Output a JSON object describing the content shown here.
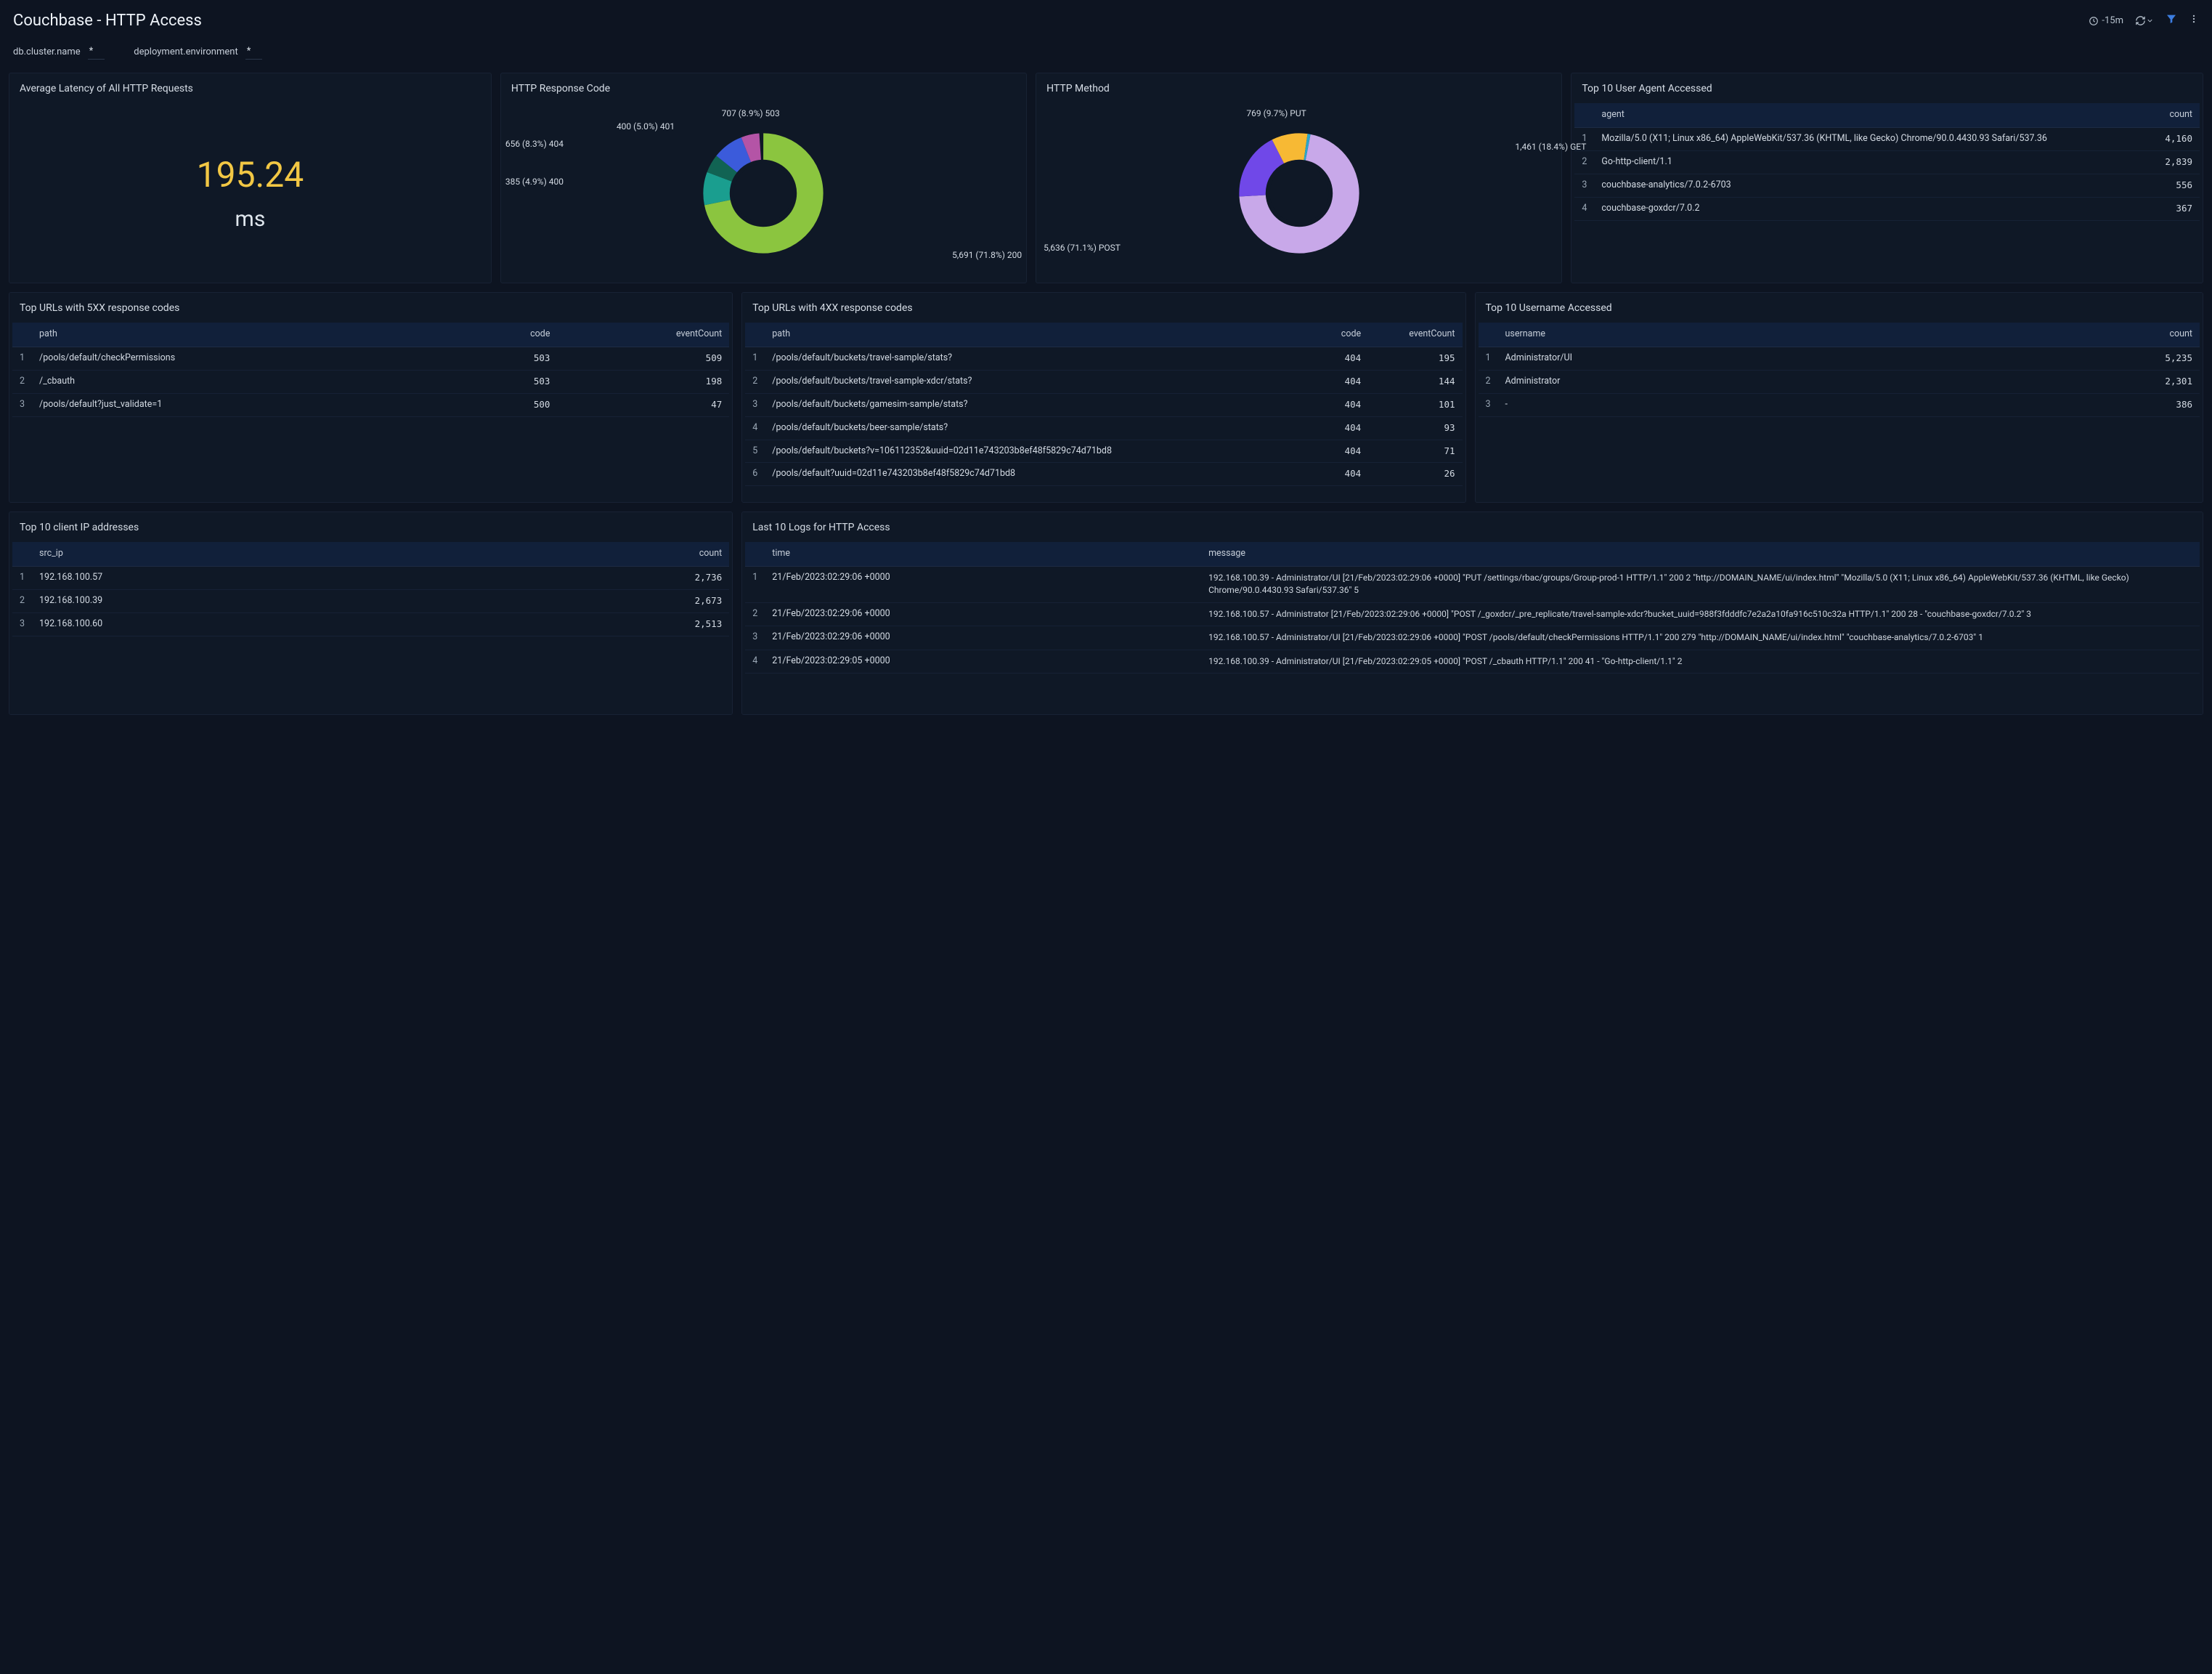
{
  "title": "Couchbase - HTTP Access",
  "time_range": "-15m",
  "filters": [
    {
      "label": "db.cluster.name",
      "value": "*"
    },
    {
      "label": "deployment.environment",
      "value": "*"
    }
  ],
  "latency": {
    "title": "Average Latency of All HTTP Requests",
    "value": "195.24",
    "unit": "ms"
  },
  "resp_code": {
    "title": "HTTP Response Code",
    "labels": {
      "c503": "707 (8.9%) 503",
      "c401": "400 (5.0%) 401",
      "c404": "656 (8.3%) 404",
      "c400": "385 (4.9%) 400",
      "c200": "5,691 (71.8%) 200"
    }
  },
  "method": {
    "title": "HTTP Method",
    "labels": {
      "put": "769 (9.7%) PUT",
      "get": "1,461 (18.4%) GET",
      "post": "5,636 (71.1%) POST"
    }
  },
  "agents": {
    "title": "Top 10 User Agent Accessed",
    "cols": {
      "agent": "agent",
      "count": "count"
    },
    "rows": [
      {
        "agent": "Mozilla/5.0 (X11; Linux x86_64) AppleWebKit/537.36 (KHTML, like Gecko) Chrome/90.0.4430.93 Safari/537.36",
        "count": "4,160"
      },
      {
        "agent": "Go-http-client/1.1",
        "count": "2,839"
      },
      {
        "agent": "couchbase-analytics/7.0.2-6703",
        "count": "556"
      },
      {
        "agent": "couchbase-goxdcr/7.0.2",
        "count": "367"
      }
    ]
  },
  "urls5xx": {
    "title": "Top URLs with 5XX response codes",
    "cols": {
      "path": "path",
      "code": "code",
      "ev": "eventCount"
    },
    "rows": [
      {
        "path": "/pools/default/checkPermissions",
        "code": "503",
        "ev": "509"
      },
      {
        "path": "/_cbauth",
        "code": "503",
        "ev": "198"
      },
      {
        "path": "/pools/default?just_validate=1",
        "code": "500",
        "ev": "47"
      }
    ]
  },
  "urls4xx": {
    "title": "Top URLs with 4XX response codes",
    "cols": {
      "path": "path",
      "code": "code",
      "ev": "eventCount"
    },
    "rows": [
      {
        "path": "/pools/default/buckets/travel-sample/stats?",
        "code": "404",
        "ev": "195"
      },
      {
        "path": "/pools/default/buckets/travel-sample-xdcr/stats?",
        "code": "404",
        "ev": "144"
      },
      {
        "path": "/pools/default/buckets/gamesim-sample/stats?",
        "code": "404",
        "ev": "101"
      },
      {
        "path": "/pools/default/buckets/beer-sample/stats?",
        "code": "404",
        "ev": "93"
      },
      {
        "path": "/pools/default/buckets?v=106112352&uuid=02d11e743203b8ef48f5829c74d71bd8",
        "code": "404",
        "ev": "71"
      },
      {
        "path": "/pools/default?uuid=02d11e743203b8ef48f5829c74d71bd8",
        "code": "404",
        "ev": "26"
      }
    ]
  },
  "users": {
    "title": "Top 10 Username Accessed",
    "cols": {
      "user": "username",
      "count": "count"
    },
    "rows": [
      {
        "user": "Administrator/UI",
        "count": "5,235"
      },
      {
        "user": "Administrator",
        "count": "2,301"
      },
      {
        "user": "-",
        "count": "386"
      }
    ]
  },
  "ips": {
    "title": "Top 10 client IP addresses",
    "cols": {
      "ip": "src_ip",
      "count": "count"
    },
    "rows": [
      {
        "ip": "192.168.100.57",
        "count": "2,736"
      },
      {
        "ip": "192.168.100.39",
        "count": "2,673"
      },
      {
        "ip": "192.168.100.60",
        "count": "2,513"
      }
    ]
  },
  "logs": {
    "title": "Last 10 Logs for HTTP Access",
    "cols": {
      "time": "time",
      "msg": "message"
    },
    "rows": [
      {
        "time": "21/Feb/2023:02:29:06 +0000",
        "msg": "192.168.100.39 - Administrator/UI [21/Feb/2023:02:29:06 +0000] \"PUT /settings/rbac/groups/Group-prod-1 HTTP/1.1\" 200 2 \"http://DOMAIN_NAME/ui/index.html\" \"Mozilla/5.0 (X11; Linux x86_64) AppleWebKit/537.36 (KHTML, like Gecko) Chrome/90.0.4430.93 Safari/537.36\" 5"
      },
      {
        "time": "21/Feb/2023:02:29:06 +0000",
        "msg": "192.168.100.57 - Administrator [21/Feb/2023:02:29:06 +0000] \"POST /_goxdcr/_pre_replicate/travel-sample-xdcr?bucket_uuid=988f3fdddfc7e2a2a10fa916c510c32a HTTP/1.1\" 200 28 - \"couchbase-goxdcr/7.0.2\" 3"
      },
      {
        "time": "21/Feb/2023:02:29:06 +0000",
        "msg": "192.168.100.57 - Administrator/UI [21/Feb/2023:02:29:06 +0000] \"POST /pools/default/checkPermissions HTTP/1.1\" 200 279 \"http://DOMAIN_NAME/ui/index.html\" \"couchbase-analytics/7.0.2-6703\" 1"
      },
      {
        "time": "21/Feb/2023:02:29:05 +0000",
        "msg": "192.168.100.39 - Administrator/UI [21/Feb/2023:02:29:05 +0000] \"POST /_cbauth HTTP/1.1\" 200 41 - \"Go-http-client/1.1\" 2"
      }
    ]
  },
  "chart_data": [
    {
      "type": "pie",
      "title": "HTTP Response Code",
      "series": [
        {
          "name": "200",
          "value": 5691,
          "pct": 71.8,
          "color": "#8bc53f"
        },
        {
          "name": "503",
          "value": 707,
          "pct": 8.9,
          "color": "#1a9e8f"
        },
        {
          "name": "404",
          "value": 656,
          "pct": 8.3,
          "color": "#3b5bdb"
        },
        {
          "name": "401",
          "value": 400,
          "pct": 5.0,
          "color": "#116353"
        },
        {
          "name": "400",
          "value": 385,
          "pct": 4.9,
          "color": "#b454a6"
        }
      ]
    },
    {
      "type": "pie",
      "title": "HTTP Method",
      "series": [
        {
          "name": "POST",
          "value": 5636,
          "pct": 71.1,
          "color": "#c8a8e9"
        },
        {
          "name": "GET",
          "value": 1461,
          "pct": 18.4,
          "color": "#7048e8"
        },
        {
          "name": "PUT",
          "value": 769,
          "pct": 9.7,
          "color": "#f7b934"
        }
      ]
    }
  ]
}
